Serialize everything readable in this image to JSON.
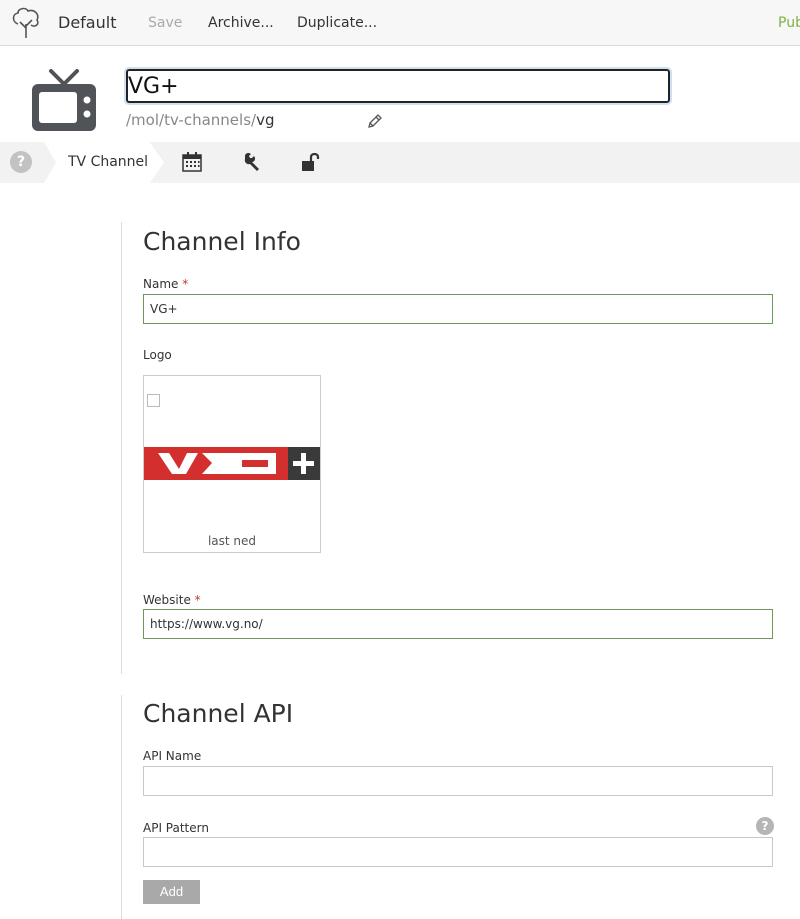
{
  "toolbar": {
    "workspace": "Default",
    "save": "Save",
    "archive": "Archive...",
    "duplicate": "Duplicate...",
    "publish": "Pub"
  },
  "header": {
    "title": "VG+",
    "path_prefix": "/mol/tv-channels/",
    "path_slug": "vg"
  },
  "tabs": {
    "help": "?",
    "active_label": "TV Channel",
    "icons": [
      "calendar-icon",
      "wrench-icon",
      "unlock-icon"
    ]
  },
  "channel_info": {
    "title": "Channel Info",
    "name_label": "Name",
    "name_value": "VG+",
    "logo_label": "Logo",
    "logo_caption": "last ned",
    "website_label": "Website",
    "website_value": "https://www.vg.no/",
    "required_mark": "*"
  },
  "channel_api": {
    "title": "Channel API",
    "api_name_label": "API Name",
    "api_name_value": "",
    "api_pattern_label": "API Pattern",
    "api_pattern_value": "",
    "help": "?",
    "add_button": "Add"
  },
  "colors": {
    "valid_border": "#6a9a55",
    "required": "#c0392b",
    "publish": "#7cb342",
    "logo_red": "#d32f2f",
    "logo_dark": "#3a3a3a"
  }
}
